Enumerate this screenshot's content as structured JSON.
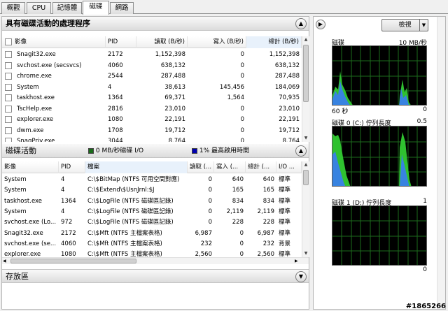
{
  "tabs": [
    "概觀",
    "CPU",
    "記憶體",
    "磁碟",
    "網路"
  ],
  "processes_section": {
    "title": "具有磁碟活動的處理程序",
    "columns": [
      "影像",
      "PID",
      "讀取 (B/秒)",
      "寫入 (B/秒)",
      "總計 (B/秒)"
    ],
    "rows": [
      {
        "image": "Snagit32.exe",
        "pid": "2172",
        "read": "1,152,398",
        "write": "0",
        "total": "1,152,398"
      },
      {
        "image": "svchost.exe (secsvcs)",
        "pid": "4060",
        "read": "638,132",
        "write": "0",
        "total": "638,132"
      },
      {
        "image": "chrome.exe",
        "pid": "2544",
        "read": "287,488",
        "write": "0",
        "total": "287,488"
      },
      {
        "image": "System",
        "pid": "4",
        "read": "38,613",
        "write": "145,456",
        "total": "184,069"
      },
      {
        "image": "taskhost.exe",
        "pid": "1364",
        "read": "69,371",
        "write": "1,564",
        "total": "70,935"
      },
      {
        "image": "TscHelp.exe",
        "pid": "2816",
        "read": "23,010",
        "write": "0",
        "total": "23,010"
      },
      {
        "image": "explorer.exe",
        "pid": "1080",
        "read": "22,191",
        "write": "0",
        "total": "22,191"
      },
      {
        "image": "dwm.exe",
        "pid": "1708",
        "read": "19,712",
        "write": "0",
        "total": "19,712"
      },
      {
        "image": "SnagPriv.exe",
        "pid": "3044",
        "read": "8,764",
        "write": "0",
        "total": "8,764"
      }
    ]
  },
  "disk_activity_section": {
    "title": "磁碟活動",
    "legend_io": "0 MB/秒磁碟 I/O",
    "legend_active": "1% 最高啟用時間",
    "legend_io_color": "#1a6b1a",
    "legend_active_color": "#0000b0",
    "columns": [
      "影像",
      "PID",
      "檔案",
      "讀取 (...",
      "寫入 (...",
      "總計 (...",
      "I/O ..."
    ],
    "rows": [
      {
        "image": "System",
        "pid": "4",
        "file": "C:\\$BitMap (NTFS 可用空間對應)",
        "read": "0",
        "write": "640",
        "total": "640",
        "io": "標準"
      },
      {
        "image": "System",
        "pid": "4",
        "file": "C:\\$Extend\\$UsnJrnl:$J",
        "read": "0",
        "write": "165",
        "total": "165",
        "io": "標準"
      },
      {
        "image": "taskhost.exe",
        "pid": "1364",
        "file": "C:\\$LogFile (NTFS 磁碟區記錄)",
        "read": "0",
        "write": "834",
        "total": "834",
        "io": "標準"
      },
      {
        "image": "System",
        "pid": "4",
        "file": "C:\\$LogFile (NTFS 磁碟區記錄)",
        "read": "0",
        "write": "2,119",
        "total": "2,119",
        "io": "標準"
      },
      {
        "image": "svchost.exe (Lo...",
        "pid": "972",
        "file": "C:\\$LogFile (NTFS 磁碟區記錄)",
        "read": "0",
        "write": "228",
        "total": "228",
        "io": "標準"
      },
      {
        "image": "Snagit32.exe",
        "pid": "2172",
        "file": "C:\\$Mft (NTFS 主檔案表格)",
        "read": "6,987",
        "write": "0",
        "total": "6,987",
        "io": "標準"
      },
      {
        "image": "svchost.exe (se...",
        "pid": "4060",
        "file": "C:\\$Mft (NTFS 主檔案表格)",
        "read": "232",
        "write": "0",
        "total": "232",
        "io": "背景"
      },
      {
        "image": "explorer.exe",
        "pid": "1080",
        "file": "C:\\$Mft (NTFS 主檔案表格)",
        "read": "2,560",
        "write": "0",
        "total": "2,560",
        "io": "標準"
      }
    ]
  },
  "storage_section": {
    "title": "存放區"
  },
  "right_panel": {
    "view_button": "檢視",
    "graphs": [
      {
        "title": "磁碟",
        "max": "10 MB/秒",
        "footer_left": "60 秒",
        "footer_right": "0"
      },
      {
        "title": "磁碟 0 (C:) 佇列長度",
        "max": "0.5",
        "footer_left": "",
        "footer_right": "0"
      },
      {
        "title": "磁碟 1 (D:) 佇列長度",
        "max": "1",
        "footer_left": "",
        "footer_right": "0"
      }
    ]
  },
  "watermark": "#1865266"
}
